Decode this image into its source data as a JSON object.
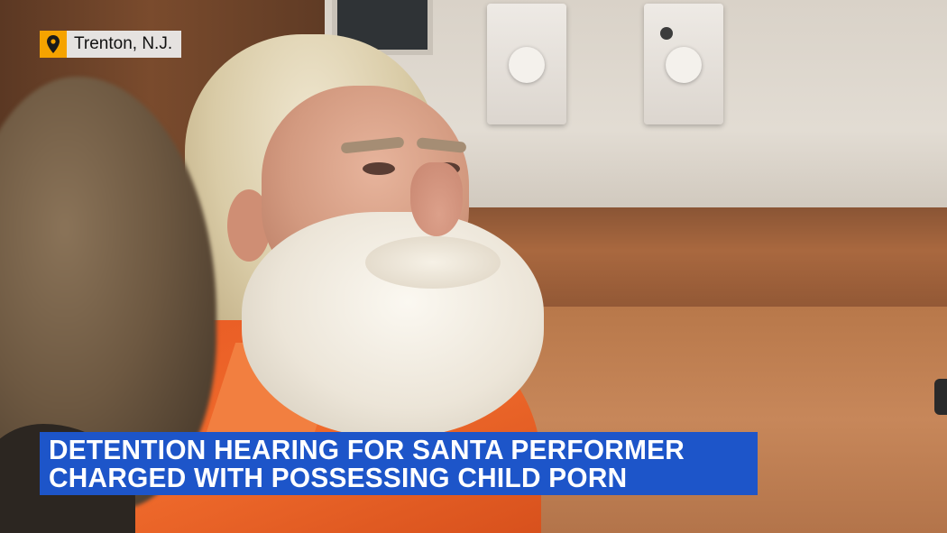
{
  "location_badge": {
    "icon": "map-pin-icon",
    "accent_color": "#f5a300",
    "text": "Trenton, N.J."
  },
  "lower_third": {
    "background_color": "#1d55c9",
    "line1": "DETENTION HEARING FOR SANTA PERFORMER",
    "line2": "CHARGED WITH POSSESSING CHILD PORN"
  }
}
